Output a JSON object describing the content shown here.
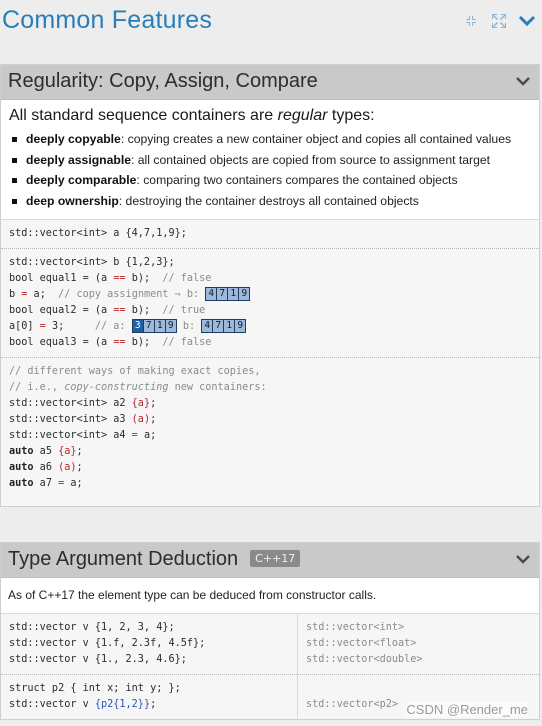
{
  "page": {
    "title": "Common Features",
    "icons": [
      "collapse-all-icon",
      "expand-all-icon",
      "chevron-down-icon"
    ]
  },
  "regularity": {
    "title": "Regularity: Copy, Assign, Compare",
    "intro_prefix": "All standard sequence containers are ",
    "intro_em": "regular",
    "intro_suffix": " types:",
    "bullets": [
      {
        "term": "deeply copyable",
        "desc": ": copying creates a new container object and copies all contained values"
      },
      {
        "term": "deeply assignable",
        "desc": ": all contained objects are copied from source to assignment target"
      },
      {
        "term": "deeply comparable",
        "desc": ": comparing two containers compares the contained objects"
      },
      {
        "term": "deep ownership",
        "desc": ": destroying the container destroys all contained objects"
      }
    ],
    "code": {
      "l1": "std::vector<int> a {4,7,1,9};",
      "l2": "std::vector<int> b {1,2,3};",
      "l3_a": "bool equal1 = (a ",
      "l3_op": "==",
      "l3_b": " b);  ",
      "l3_c": "// false",
      "l4_a": "b ",
      "l4_op": "=",
      "l4_b": " a;  ",
      "l4_c": "// copy assignment ⇒ b: ",
      "l5_a": "bool equal2 = (a ",
      "l5_op": "==",
      "l5_b": " b);  ",
      "l5_c": "// true",
      "l6_a": "a[0] ",
      "l6_op": "=",
      "l6_b": " 3;     ",
      "l6_c": "// a: ",
      "l6_d": " b: ",
      "l7_a": "bool equal3 = (a ",
      "l7_op": "==",
      "l7_b": " b);  ",
      "l7_c": "// false",
      "l8": "// different ways of making exact copies,",
      "l9_a": "// i.e., ",
      "l9_em": "copy-constructing",
      "l9_b": " new containers:",
      "l10_a": "std::vector<int> a2 ",
      "l10_b": "{a}",
      "l10_c": ";",
      "l11_a": "std::vector<int> a3 ",
      "l11_b": "(a)",
      "l11_c": ";",
      "l12_a": "std::vector<int> a4 ",
      "l12_op": "=",
      "l12_b": " a;",
      "l13_kw": "auto",
      "l13_a": " a5 ",
      "l13_b": "{a}",
      "l13_c": ";",
      "l14_kw": "auto",
      "l14_a": " a6 ",
      "l14_b": "(a)",
      "l14_c": ";",
      "l15_kw": "auto",
      "l15_a": " a7 ",
      "l15_op": "=",
      "l15_b": " a;"
    },
    "arr_b_after_assign": [
      "4",
      "7",
      "1",
      "9"
    ],
    "arr_a_after_change": [
      "3",
      "7",
      "1",
      "9"
    ],
    "arr_b_after_change": [
      "4",
      "7",
      "1",
      "9"
    ]
  },
  "deduction": {
    "title": "Type Argument Deduction",
    "badge": "C++17",
    "intro": "As of C++17 the element type can be deduced from constructor calls.",
    "left": {
      "l1": "std::vector v {1, 2, 3, 4};",
      "l2": "std::vector v {1.f, 2.3f, 4.5f};",
      "l3": "std::vector v {1., 2.3, 4.6};",
      "l4": "struct p2 { int x; int y; };",
      "l5_a": "std::vector v ",
      "l5_b": "{p2{1,2}}",
      "l5_c": ";"
    },
    "right": {
      "r1": "std::vector<int>",
      "r2": "std::vector<float>",
      "r3": "std::vector<double>",
      "r4": "std::vector<p2>"
    }
  },
  "watermark": "CSDN @Render_me",
  "colors": {
    "title_blue": "#2a7db8",
    "header_gray": "#c9c9c9",
    "array_fill": "#9db8db",
    "array_highlight": "#1e5fa7"
  }
}
